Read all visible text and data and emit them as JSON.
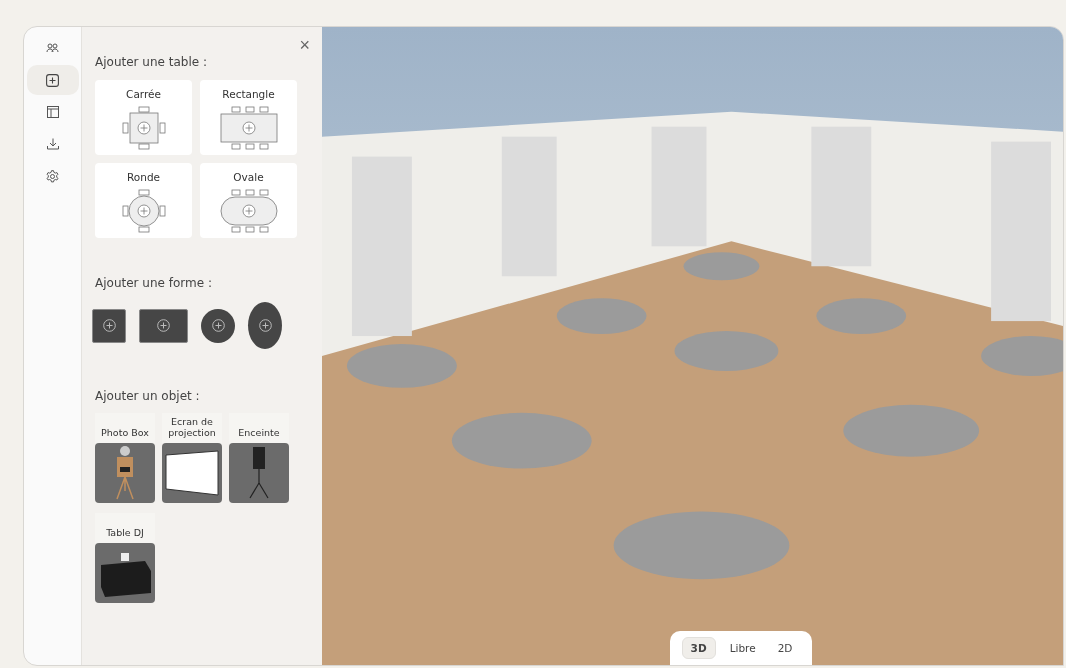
{
  "rail": [
    {
      "kind": "people",
      "selected": false
    },
    {
      "kind": "add",
      "selected": true
    },
    {
      "kind": "layout",
      "selected": false
    },
    {
      "kind": "download",
      "selected": false
    },
    {
      "kind": "settings",
      "selected": false
    }
  ],
  "panel": {
    "close": "×",
    "tables": {
      "title": "Ajouter une table :",
      "items": [
        {
          "label": "Carrée",
          "kind": "square"
        },
        {
          "label": "Rectangle",
          "kind": "rect"
        },
        {
          "label": "Ronde",
          "kind": "round"
        },
        {
          "label": "Ovale",
          "kind": "oval"
        }
      ]
    },
    "shapes": {
      "title": "Ajouter une forme :",
      "items": [
        {
          "kind": "square"
        },
        {
          "kind": "rect"
        },
        {
          "kind": "circle"
        },
        {
          "kind": "oval"
        }
      ]
    },
    "objects": {
      "title": "Ajouter un objet :",
      "items": [
        {
          "label": "Photo Box",
          "kind": "photobox"
        },
        {
          "label": "Ecran de projection",
          "kind": "screen"
        },
        {
          "label": "Enceinte",
          "kind": "speaker"
        },
        {
          "label": "Table DJ",
          "kind": "dj"
        }
      ]
    }
  },
  "view_modes": [
    {
      "label": "3D",
      "selected": true
    },
    {
      "label": "Libre",
      "selected": false
    },
    {
      "label": "2D",
      "selected": false
    }
  ]
}
